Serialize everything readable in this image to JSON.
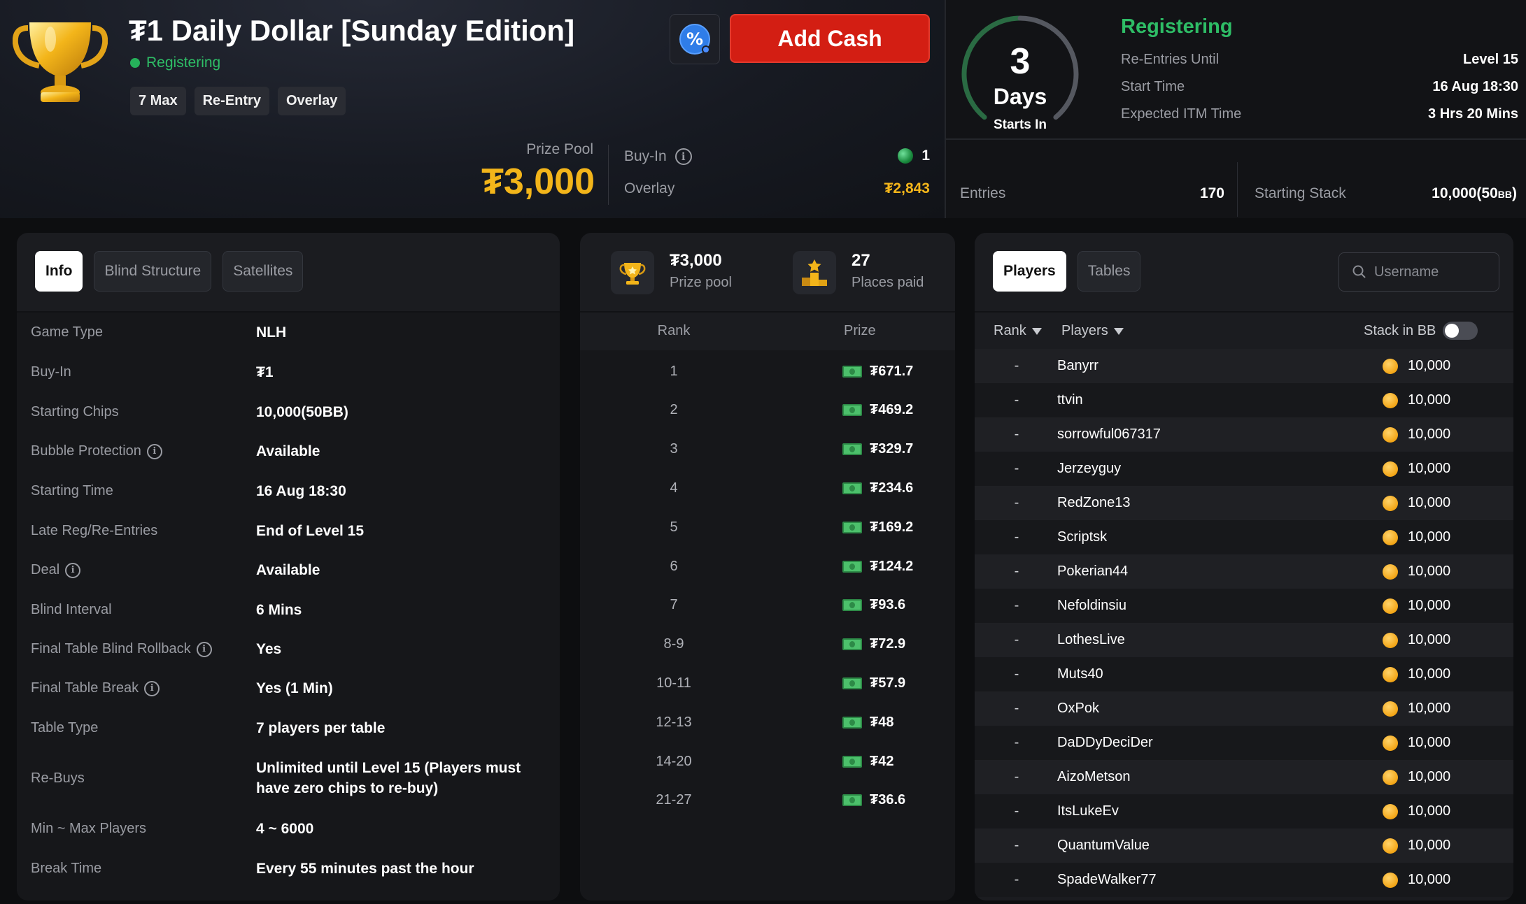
{
  "header": {
    "title": "₮1 Daily Dollar [Sunday Edition]",
    "status": "Registering",
    "tags": [
      "7 Max",
      "Re-Entry",
      "Overlay"
    ],
    "add_cash_label": "Add Cash",
    "promo_icon": "percent-badge-icon",
    "prize_pool_label": "Prize Pool",
    "prize_pool_value": "₮3,000",
    "buyin_label": "Buy-In",
    "buyin_value": "1",
    "overlay_label": "Overlay",
    "overlay_value": "₮2,843"
  },
  "countdown": {
    "number": "3",
    "unit": "Days",
    "label": "Starts In",
    "arc_fraction": 0.78
  },
  "registration": {
    "title": "Registering",
    "rows": [
      {
        "key": "Re-Entries Until",
        "value": "Level 15"
      },
      {
        "key": "Start Time",
        "value": "16 Aug 18:30"
      },
      {
        "key": "Expected ITM Time",
        "value": "3 Hrs 20 Mins"
      }
    ],
    "entries_label": "Entries",
    "entries_value": "170",
    "starting_stack_label": "Starting Stack",
    "starting_stack_value": "10,000(50",
    "starting_stack_unit": "BB",
    "starting_stack_close": ")"
  },
  "info_panel": {
    "tabs": [
      "Info",
      "Blind Structure",
      "Satellites"
    ],
    "rows": [
      {
        "key": "Game Type",
        "value": "NLH",
        "info": false
      },
      {
        "key": "Buy-In",
        "value": "₮1",
        "info": false
      },
      {
        "key": "Starting Chips",
        "value": "10,000(50BB)",
        "info": false
      },
      {
        "key": "Bubble Protection",
        "value": "Available",
        "info": true
      },
      {
        "key": "Starting Time",
        "value": "16 Aug 18:30",
        "info": false
      },
      {
        "key": "Late Reg/Re-Entries",
        "value": "End of Level 15",
        "info": false
      },
      {
        "key": "Deal",
        "value": "Available",
        "info": true
      },
      {
        "key": "Blind Interval",
        "value": "6 Mins",
        "info": false
      },
      {
        "key": "Final Table Blind Rollback",
        "value": "Yes",
        "info": true
      },
      {
        "key": "Final Table Break",
        "value": "Yes (1 Min)",
        "info": true
      },
      {
        "key": "Table Type",
        "value": "7 players per table",
        "info": false
      },
      {
        "key": "Re-Buys",
        "value": "Unlimited until Level 15 (Players must have zero chips to re-buy)",
        "info": false
      },
      {
        "key": "Min ~ Max Players",
        "value": "4 ~ 6000",
        "info": false
      },
      {
        "key": "Break Time",
        "value": "Every 55 minutes past the hour",
        "info": false
      }
    ]
  },
  "prize_panel": {
    "pool_value": "₮3,000",
    "pool_label": "Prize pool",
    "places_value": "27",
    "places_label": "Places paid",
    "col_rank": "Rank",
    "col_prize": "Prize",
    "rows": [
      {
        "rank": "1",
        "prize": "₮671.7"
      },
      {
        "rank": "2",
        "prize": "₮469.2"
      },
      {
        "rank": "3",
        "prize": "₮329.7"
      },
      {
        "rank": "4",
        "prize": "₮234.6"
      },
      {
        "rank": "5",
        "prize": "₮169.2"
      },
      {
        "rank": "6",
        "prize": "₮124.2"
      },
      {
        "rank": "7",
        "prize": "₮93.6"
      },
      {
        "rank": "8-9",
        "prize": "₮72.9"
      },
      {
        "rank": "10-11",
        "prize": "₮57.9"
      },
      {
        "rank": "12-13",
        "prize": "₮48"
      },
      {
        "rank": "14-20",
        "prize": "₮42"
      },
      {
        "rank": "21-27",
        "prize": "₮36.6"
      }
    ]
  },
  "players_panel": {
    "tabs": [
      "Players",
      "Tables"
    ],
    "search_placeholder": "Username",
    "col_rank": "Rank",
    "col_players": "Players",
    "col_stack": "Stack in BB",
    "rows": [
      {
        "rank": "-",
        "name": "Banyrr",
        "stack": "10,000"
      },
      {
        "rank": "-",
        "name": "ttvin",
        "stack": "10,000"
      },
      {
        "rank": "-",
        "name": "sorrowful067317",
        "stack": "10,000"
      },
      {
        "rank": "-",
        "name": "Jerzeyguy",
        "stack": "10,000"
      },
      {
        "rank": "-",
        "name": "RedZone13",
        "stack": "10,000"
      },
      {
        "rank": "-",
        "name": "Scriptsk",
        "stack": "10,000"
      },
      {
        "rank": "-",
        "name": "Pokerian44",
        "stack": "10,000"
      },
      {
        "rank": "-",
        "name": "Nefoldinsiu",
        "stack": "10,000"
      },
      {
        "rank": "-",
        "name": "LothesLive",
        "stack": "10,000"
      },
      {
        "rank": "-",
        "name": "Muts40",
        "stack": "10,000"
      },
      {
        "rank": "-",
        "name": "OxPok",
        "stack": "10,000"
      },
      {
        "rank": "-",
        "name": "DaDDyDeciDer",
        "stack": "10,000"
      },
      {
        "rank": "-",
        "name": "AizoMetson",
        "stack": "10,000"
      },
      {
        "rank": "-",
        "name": "ItsLukeEv",
        "stack": "10,000"
      },
      {
        "rank": "-",
        "name": "QuantumValue",
        "stack": "10,000"
      },
      {
        "rank": "-",
        "name": "SpadeWalker77",
        "stack": "10,000"
      }
    ]
  },
  "colors": {
    "accent_gold": "#f3b51a",
    "status_green": "#2ebd66",
    "add_cash_red": "#d31e13"
  }
}
